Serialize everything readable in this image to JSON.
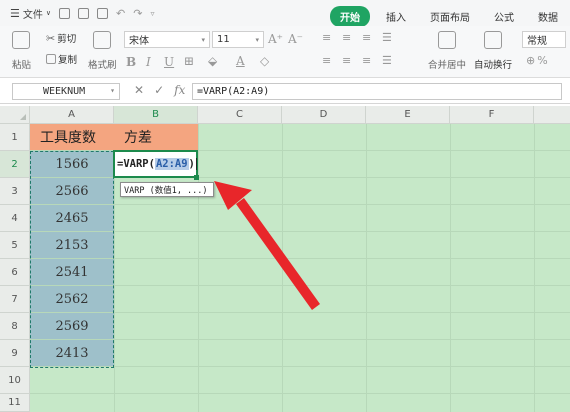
{
  "menubar": {
    "file_label": "文件",
    "tabs": [
      "开始",
      "插入",
      "页面布局",
      "公式",
      "数据"
    ]
  },
  "ribbon": {
    "paste_label": "粘贴",
    "cut_label": "剪切",
    "copy_label": "复制",
    "format_painter_label": "格式刷",
    "font_name": "宋体",
    "font_size": "11",
    "merge_center_label": "合并居中",
    "wrap_text_label": "自动换行",
    "number_format": "常规",
    "percent_label": "%"
  },
  "formula_bar": {
    "name_box": "WEEKNUM",
    "fx_label": "fx",
    "formula": "=VARP(A2:A9)"
  },
  "grid": {
    "columns": [
      "A",
      "B",
      "C",
      "D",
      "E",
      "F"
    ],
    "rows": [
      "1",
      "2",
      "3",
      "4",
      "5",
      "6",
      "7",
      "8",
      "9",
      "10",
      "11"
    ],
    "header_a": "工具度数",
    "header_b": "方差",
    "values": [
      "1566",
      "2566",
      "2465",
      "2153",
      "2541",
      "2562",
      "2569",
      "2413"
    ],
    "active_formula_prefix": "=VARP(",
    "active_formula_ref": "A2:A9",
    "active_formula_suffix": ")",
    "tooltip": "VARP (数值1, ...)"
  },
  "colors": {
    "accent_green": "#1fa463",
    "sheet_background": "#c6e8c8",
    "header_fill": "#f4a580",
    "value_fill": "#9ec0ca",
    "arrow": "#e8262a"
  }
}
